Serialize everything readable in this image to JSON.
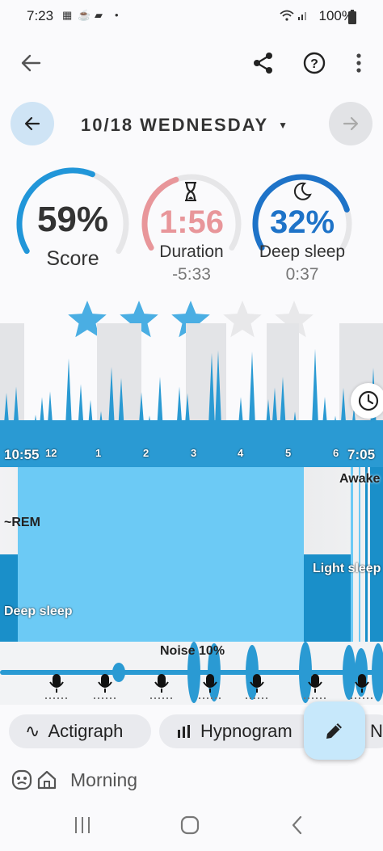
{
  "status_bar": {
    "time": "7:23",
    "battery": "100%"
  },
  "toolbar": {
    "back": "back-arrow-icon",
    "share": "share-icon",
    "help": "help-icon",
    "more": "more-icon"
  },
  "date_nav": {
    "date": "10/18 WEDNESDAY"
  },
  "gauges": {
    "score": {
      "value": "59%",
      "label": "Score",
      "fraction": 0.59,
      "color": "#2196d9"
    },
    "duration": {
      "value": "1:56",
      "label": "Duration",
      "sub": "-5:33",
      "fraction": 0.42,
      "color": "#e8969a"
    },
    "deep": {
      "value": "32%",
      "label": "Deep sleep",
      "sub": "0:37",
      "fraction": 0.8,
      "color": "#1e73c8"
    }
  },
  "rating": {
    "stars": 3,
    "max": 5
  },
  "actigraph": {
    "time_labels": [
      "10:55",
      "12",
      "1",
      "2",
      "3",
      "4",
      "5",
      "6",
      "7:05"
    ]
  },
  "hypnogram": {
    "awake_label": "Awake",
    "rem_label": "~REM",
    "light_label": "Light sleep",
    "deep_label": "Deep sleep"
  },
  "noise": {
    "label": "Noise 10%"
  },
  "chips": {
    "actigraph": "Actigraph",
    "hypnogram": "Hypnogram",
    "cut": "N"
  },
  "tags": {
    "morning": "Morning"
  },
  "colors": {
    "accent": "#2196d9",
    "light_blue": "#6ccaf5",
    "dark_blue": "#1a8fc9",
    "fab": "#c7e8fb"
  }
}
